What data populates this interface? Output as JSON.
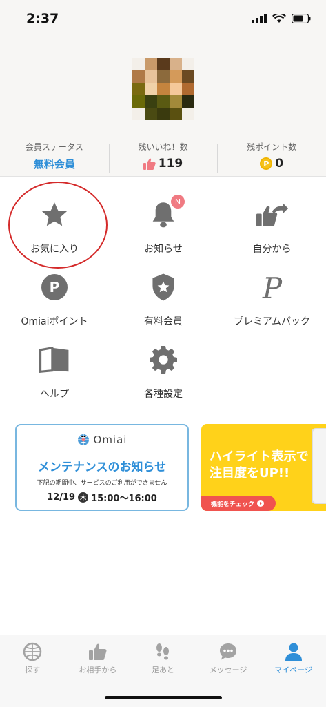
{
  "status_bar": {
    "time": "2:37"
  },
  "profile": {
    "stats": [
      {
        "label": "会員ステータス",
        "value": "無料会員"
      },
      {
        "label": "残いいね！数",
        "value": "119"
      },
      {
        "label": "残ポイント数",
        "value": "0"
      }
    ],
    "coin_symbol": "P"
  },
  "menu": {
    "items": [
      {
        "label": "お気に入り",
        "icon": "star-icon"
      },
      {
        "label": "お知らせ",
        "icon": "bell-icon",
        "badge": "N"
      },
      {
        "label": "自分から",
        "icon": "thumb-arrow-icon"
      },
      {
        "label": "Omiaiポイント",
        "icon": "point-icon",
        "glyph": "P"
      },
      {
        "label": "有料会員",
        "icon": "shield-star-icon"
      },
      {
        "label": "プレミアムパック",
        "icon": "premium-p-icon",
        "glyph": "P"
      },
      {
        "label": "ヘルプ",
        "icon": "book-icon"
      },
      {
        "label": "各種設定",
        "icon": "gear-icon"
      }
    ]
  },
  "banners": {
    "maintenance": {
      "brand": "Omiai",
      "title": "メンテナンスのお知らせ",
      "description": "下記の期間中、サービスのご利用ができません",
      "date": "12/19",
      "day": "木",
      "time": "15:00〜16:00"
    },
    "highlight": {
      "line1": "ハイライト表示で",
      "line2": "注目度をUP!!",
      "cta": "機能をチェック"
    }
  },
  "tab_bar": {
    "tabs": [
      {
        "label": "探す",
        "icon": "globe-icon",
        "active": false
      },
      {
        "label": "お相手から",
        "icon": "thumbs-up-icon",
        "active": false
      },
      {
        "label": "足あと",
        "icon": "footprints-icon",
        "active": false
      },
      {
        "label": "メッセージ",
        "icon": "chat-icon",
        "active": false
      },
      {
        "label": "マイページ",
        "icon": "person-icon",
        "active": true
      }
    ]
  },
  "colors": {
    "accent_blue": "#2f8fd8",
    "icon_gray": "#7a7a7a",
    "highlight_circle": "#d42a2a",
    "badge_pink": "#f07a82",
    "banner_yellow": "#ffd21a"
  }
}
